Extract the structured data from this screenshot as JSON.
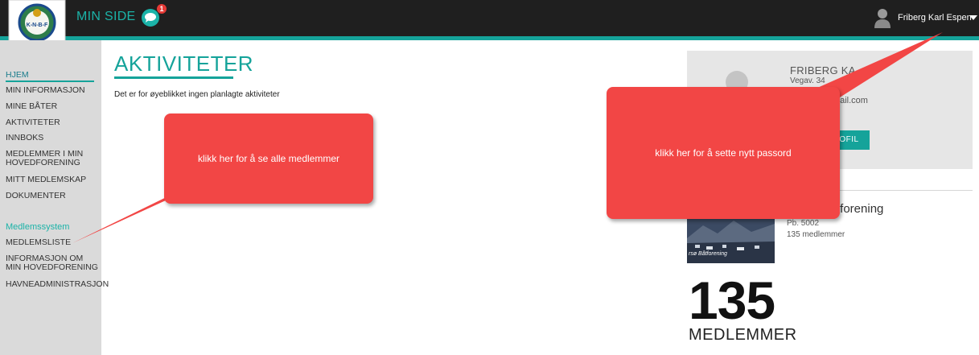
{
  "header": {
    "brand": "MIN SIDE",
    "chat_badge": "1",
    "user_name": "Friberg Karl Espen",
    "logo_text": "K-N-B-F"
  },
  "sidebar": {
    "items": [
      {
        "label": "HJEM",
        "active": true
      },
      {
        "label": "MIN INFORMASJON"
      },
      {
        "label": "MINE BÅTER"
      },
      {
        "label": "AKTIVITETER"
      },
      {
        "label": "INNBOKS"
      },
      {
        "label": "MEDLEMMER I MIN HOVEDFORENING"
      },
      {
        "label": "MITT MEDLEMSKAP"
      },
      {
        "label": "DOKUMENTER"
      }
    ],
    "section_title": "Medlemssystem",
    "section_items": [
      {
        "label": "MEDLEMSLISTE"
      },
      {
        "label": "INFORMASJON OM MIN HOVEDFORENING"
      },
      {
        "label": "HAVNEADMINISTRASJON"
      }
    ]
  },
  "main": {
    "title": "AKTIVITETER",
    "empty_message": "Det er for øyeblikket ingen planlagte aktiviteter"
  },
  "profile": {
    "name": "FRIBERG KA",
    "address": "Vegav. 34",
    "email": "nail.com",
    "button_label": "OFIL"
  },
  "organization": {
    "name": "tforening",
    "address": "Pb. 5002",
    "member_count": "135 medlemmer",
    "photo_caption": "rsø Båtforening"
  },
  "stats": {
    "count": "135",
    "label": "MEDLEMMER"
  },
  "callouts": {
    "left": "klikk her for å se alle medlemmer",
    "right": "klikk her for å sette nytt passord"
  },
  "colors": {
    "accent": "#15a39a",
    "callout": "#f24645",
    "topbar": "#1f1f1f",
    "sidebar": "#dadada"
  }
}
